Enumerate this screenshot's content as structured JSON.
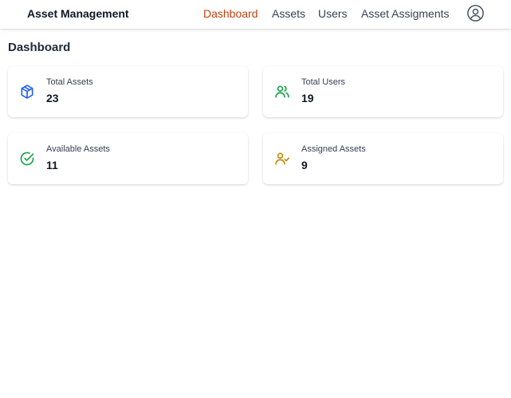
{
  "navbar": {
    "brand": "Asset Management",
    "links": [
      {
        "label": "Dashboard",
        "active": true
      },
      {
        "label": "Assets",
        "active": false
      },
      {
        "label": "Users",
        "active": false
      },
      {
        "label": "Asset Assigments",
        "active": false
      }
    ],
    "profile_icon": "user-circle-icon",
    "active_color": "#c2410c"
  },
  "page": {
    "title": "Dashboard"
  },
  "stats": [
    {
      "label": "Total Assets",
      "value": "23",
      "icon": "cube-icon",
      "color": "#2563eb"
    },
    {
      "label": "Total Users",
      "value": "19",
      "icon": "users-icon",
      "color": "#16a34a"
    },
    {
      "label": "Available Assets",
      "value": "11",
      "icon": "check-circle-icon",
      "color": "#16a34a"
    },
    {
      "label": "Assigned Assets",
      "value": "9",
      "icon": "user-check-icon",
      "color": "#ca8a04"
    }
  ]
}
